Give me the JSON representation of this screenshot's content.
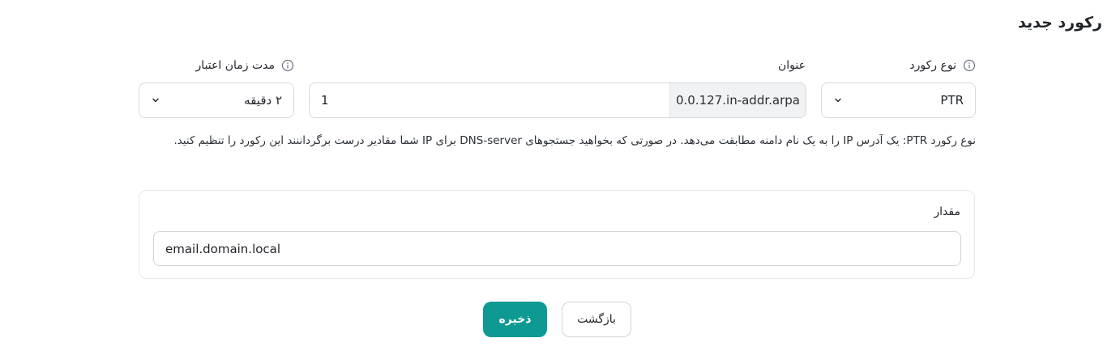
{
  "page": {
    "title": "رکورد جدید"
  },
  "record_type": {
    "label": "نوع رکورد",
    "value": "PTR"
  },
  "title_field": {
    "label": "عنوان",
    "value": "1",
    "suffix": "0.0.127.in-addr.arpa"
  },
  "ttl": {
    "label": "مدت زمان اعتبار",
    "value": "۲ دقیقه"
  },
  "help_text": "نوع رکورد PTR: یک آدرس IP را به یک نام دامنه مطابقت می‌دهد. در صورتی که بخواهید جستجوهای DNS-server برای IP شما مقادیر درست برگرداننند این رکورد را تنظیم کنید.",
  "value_section": {
    "label": "مقدار",
    "value": "email.domain.local"
  },
  "actions": {
    "save_label": "ذخیره",
    "back_label": "بازگشت"
  },
  "colors": {
    "primary": "#0e9a93",
    "suffix_bg": "#f1f2f4",
    "border": "#d5d9de"
  },
  "icons": {
    "info": "info-circle-icon",
    "chevron": "chevron-down-icon"
  }
}
